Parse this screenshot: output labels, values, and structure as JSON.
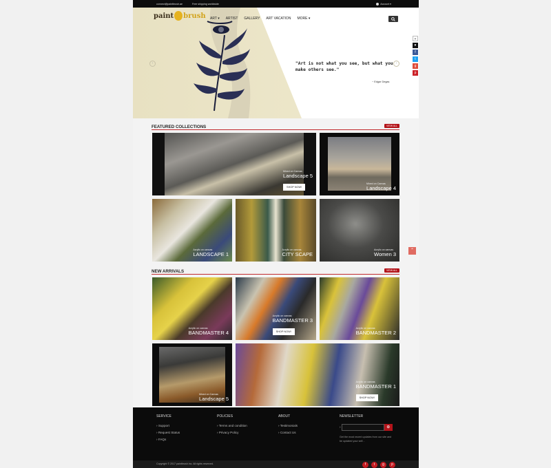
{
  "topbar": {
    "email": "connect@paintbrush.ae",
    "shipping": "Free shipping worldwide",
    "account": "Account ▾"
  },
  "brand": {
    "word1": "paint",
    "word2": "brush"
  },
  "nav": [
    "ART ▾",
    "ARTIST",
    "GALLERY",
    "ART VACATION",
    "MORE ▾"
  ],
  "hero": {
    "quote": "\"Art is not what you see, but what you make others see.\"",
    "author": "~ Edgar Degas"
  },
  "side_social": [
    "+",
    "♥",
    "f",
    "t",
    "g",
    "p"
  ],
  "featured": {
    "title": "FEATURED COLLECTIONS",
    "view_all": "VIEW ALL",
    "items": [
      {
        "medium": "Mixed on Canvas",
        "name": "Landscape 5",
        "shop": "SHOP NOW!"
      },
      {
        "medium": "Mixed on Canvas",
        "name": "Landscape 4"
      },
      {
        "medium": "Acrylic on canvas",
        "name": "LANDSCAPE 1"
      },
      {
        "medium": "Acrylic on canvas",
        "name": "CITY SCAPE"
      },
      {
        "medium": "Acrylic on canvas",
        "name": "Women 3"
      }
    ]
  },
  "arrivals": {
    "title": "NEW ARRIVALS",
    "view_all": "VIEW ALL",
    "items": [
      {
        "medium": "Acrylic on canvas",
        "name": "BANDMASTER 4"
      },
      {
        "medium": "Acrylic on canvas",
        "name": "BANDMASTER 3",
        "shop": "SHOP NOW!"
      },
      {
        "medium": "Acrylic on canvas",
        "name": "BANDMASTER 2"
      },
      {
        "medium": "Mixed on Canvas",
        "name": "Landscape 5"
      },
      {
        "medium": "Acrylic on canvas",
        "name": "BANDMASTER 1",
        "shop": "SHOP NOW!"
      }
    ]
  },
  "footer": {
    "service": {
      "title": "SERVICE",
      "items": [
        "Support",
        "Request Status",
        "FAQs"
      ]
    },
    "policies": {
      "title": "POLICIES",
      "items": [
        "Terms and condition",
        "Privacy Policy"
      ]
    },
    "about": {
      "title": "ABOUT",
      "items": [
        "Testimonials",
        "Contact Us"
      ]
    },
    "newsletter": {
      "title": "NEWSLETTER",
      "placeholder": "Email Address",
      "text": "Get the most recent updates from our site and be updated your self..."
    },
    "copyright": "Copyright © 2017 paintbrush inc. All rights reserved.",
    "social": [
      "f",
      "t",
      "g",
      "p"
    ]
  },
  "colors": {
    "accent": "#b3141a",
    "dark": "#0d0d0d",
    "hero_bg": "#e8e1c2"
  }
}
